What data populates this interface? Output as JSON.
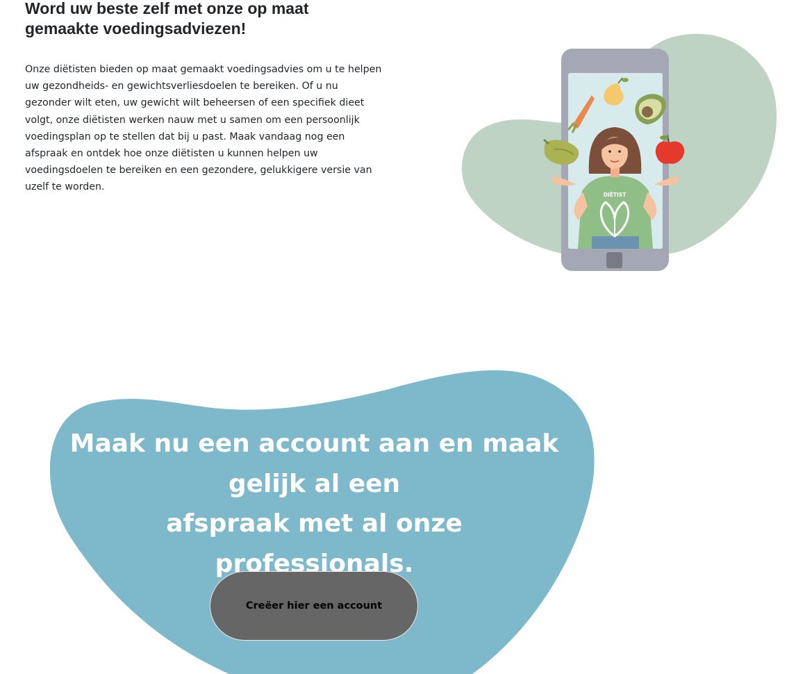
{
  "intro": {
    "heading": "Word uw beste zelf met onze op maat gemaakte voedingsadviezen!",
    "paragraph": "Onze diëtisten bieden op maat gemaakt voedingsadvies om u te helpen uw gezondheids- en gewichtsverliesdoelen te bereiken. Of u nu gezonder wilt eten, uw gewicht wilt beheersen of een specifiek dieet volgt, onze diëtisten werken nauw met u samen om een persoonlijk voedingsplan op te stellen dat bij u past. Maak vandaag nog een afspraak en ontdek hoe onze diëtisten u kunnen helpen uw voedingsdoelen te bereiken en een gezondere, gelukkigere versie van uzelf te worden."
  },
  "illustration": {
    "shirt_text": "DIËTIST",
    "icons": [
      "phone-icon",
      "carrot-icon",
      "pear-icon",
      "avocado-icon",
      "apple-icon",
      "pepper-icon",
      "dietitian-figure"
    ]
  },
  "cta": {
    "heading_line1": "Maak nu een account aan en maak gelijk al een",
    "heading_line2": "afspraak met al onze professionals.",
    "button_label": "Creëer hier een account"
  },
  "colors": {
    "sage_blob": "#bed3c4",
    "cta_blob": "#7db9cb",
    "button_bg": "#666666",
    "phone_frame": "#a4a8b5",
    "phone_screen": "#d7eaec"
  }
}
